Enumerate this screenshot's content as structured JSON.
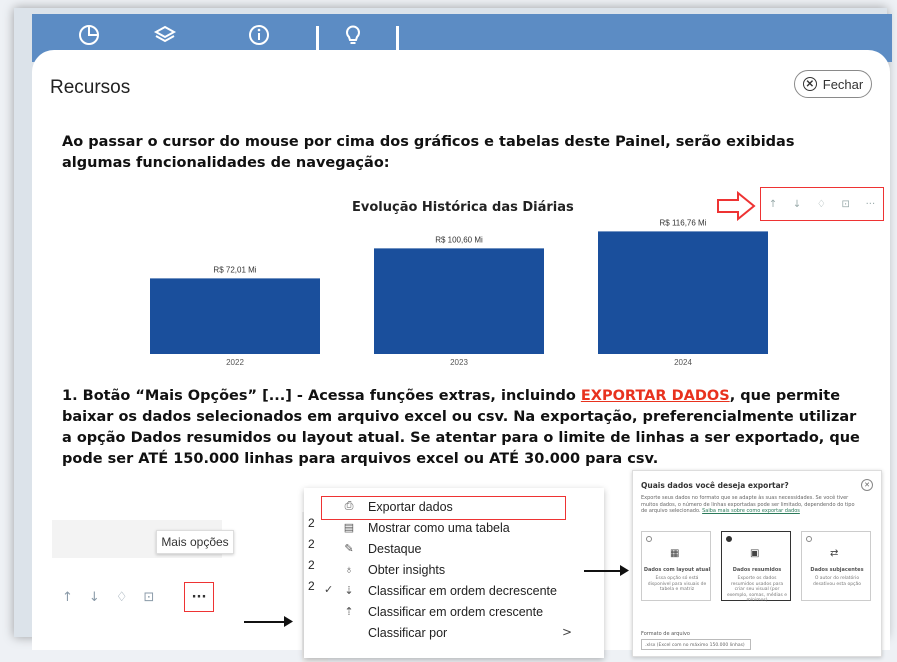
{
  "topbar": {
    "icons": [
      "chart-pie-icon",
      "layers-icon",
      "info-icon",
      "lightbulb-icon"
    ],
    "color": "#5c8cc4"
  },
  "panel": {
    "title": "Recursos",
    "close_label": "Fechar"
  },
  "intro_text": "Ao passar o cursor do mouse por cima dos gráficos e tabelas deste Painel, serão exibidas algumas funcionalidades de navegação:",
  "chart_data": {
    "type": "bar",
    "title": "Evolução Histórica das Diárias",
    "categories": [
      "2022",
      "2023",
      "2024"
    ],
    "values": [
      72.01,
      100.6,
      116.76
    ],
    "data_labels": [
      "R$ 72,01 Mi",
      "R$ 100,60 Mi",
      "R$ 116,76 Mi"
    ],
    "bar_color": "#1a4f9c",
    "ylim": [
      0,
      120
    ],
    "grid": false
  },
  "chart_header_icons": [
    "arrow-up-icon",
    "arrow-down-icon",
    "pin-icon",
    "expand-icon",
    "more-options-icon"
  ],
  "description": {
    "before": "1. Botão “Mais Opções” [...] - Acessa funções extras, incluindo ",
    "highlight": "EXPORTAR DADOS",
    "after": ", que permite baixar os dados selecionados em arquivo excel ou csv. Na exportação, preferencialmente utilizar a opção Dados resumidos ou layout atual. Se atentar para o limite de linhas a ser exportado, que pode ser ATÉ 150.000 linhas para arquivos excel ou ATÉ 30.000 para csv.",
    "highlight_color": "#e8321e"
  },
  "example": {
    "tooltip": "Mais opções",
    "more_symbol": "···"
  },
  "menu": {
    "items": [
      {
        "label": "Exportar dados",
        "icon": "export-icon",
        "glyph": "⎙"
      },
      {
        "label": "Mostrar como uma tabela",
        "icon": "table-icon",
        "glyph": "▤"
      },
      {
        "label": "Destaque",
        "icon": "spotlight-icon",
        "glyph": "✎"
      },
      {
        "label": "Obter insights",
        "icon": "lightbulb-icon",
        "glyph": "♁"
      },
      {
        "label": "Classificar em ordem decrescente",
        "icon": "sort-desc-icon",
        "glyph": "⇣"
      },
      {
        "label": "Classificar em ordem crescente",
        "icon": "sort-asc-icon",
        "glyph": "⇡"
      },
      {
        "label": "Classificar por",
        "icon": "sort-by-icon",
        "glyph": ""
      }
    ],
    "side_numbers": [
      "2",
      "2",
      "2",
      "2"
    ],
    "sort_by_chevron": ">"
  },
  "dialog": {
    "title": "Quais dados você deseja exportar?",
    "description": "Exporte seus dados no formato que se adapte às suas necessidades. Se você tiver muitos dados, o número de linhas exportadas pode ser limitado, dependendo do tipo de arquivo selecionado.",
    "link": "Saiba mais sobre como exportar dados",
    "options": [
      {
        "label": "Dados com layout atual",
        "desc": "Essa opção só está disponível para visuais de tabela e matriz",
        "selected": false
      },
      {
        "label": "Dados resumidos",
        "desc": "Exporte os dados resumidos usados para criar seu visual (por exemplo, somas, médias e mínimos)",
        "selected": true
      },
      {
        "label": "Dados subjacentes",
        "desc": "O autor do relatório desativou esta opção",
        "selected": false
      }
    ],
    "format_label": "Formato de arquivo",
    "format_value": ".xlsx (Excel com no máximo 150.000 linhas)"
  }
}
